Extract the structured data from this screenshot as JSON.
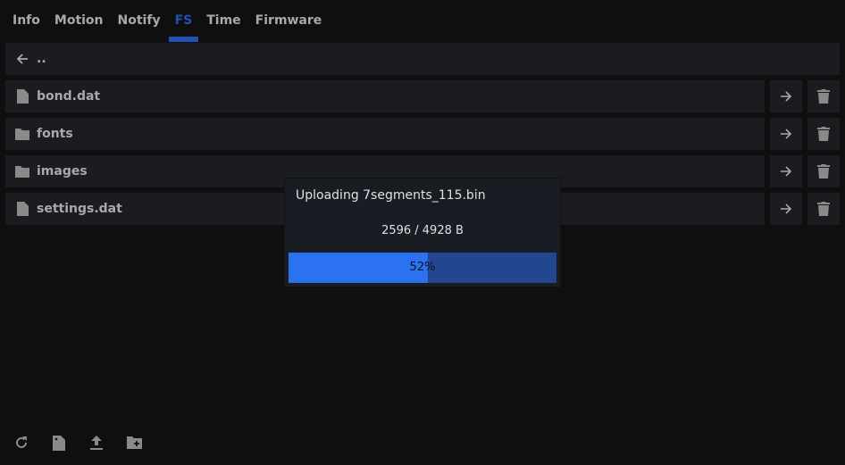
{
  "tabs": [
    {
      "label": "Info"
    },
    {
      "label": "Motion"
    },
    {
      "label": "Notify"
    },
    {
      "label": "FS",
      "active": true
    },
    {
      "label": "Time"
    },
    {
      "label": "Firmware"
    }
  ],
  "parent": {
    "label": ".."
  },
  "files": [
    {
      "name": "bond.dat",
      "type": "file"
    },
    {
      "name": "fonts",
      "type": "folder"
    },
    {
      "name": "images",
      "type": "folder"
    },
    {
      "name": "settings.dat",
      "type": "file"
    }
  ],
  "upload": {
    "title": "Uploading 7segments_115.bin",
    "size_text": "2596 / 4928 B",
    "percent_text": "52%",
    "progress": 0.52
  },
  "colors": {
    "accent": "#2251b5",
    "progress_fill": "#2b72f0",
    "progress_track": "#22468f"
  }
}
